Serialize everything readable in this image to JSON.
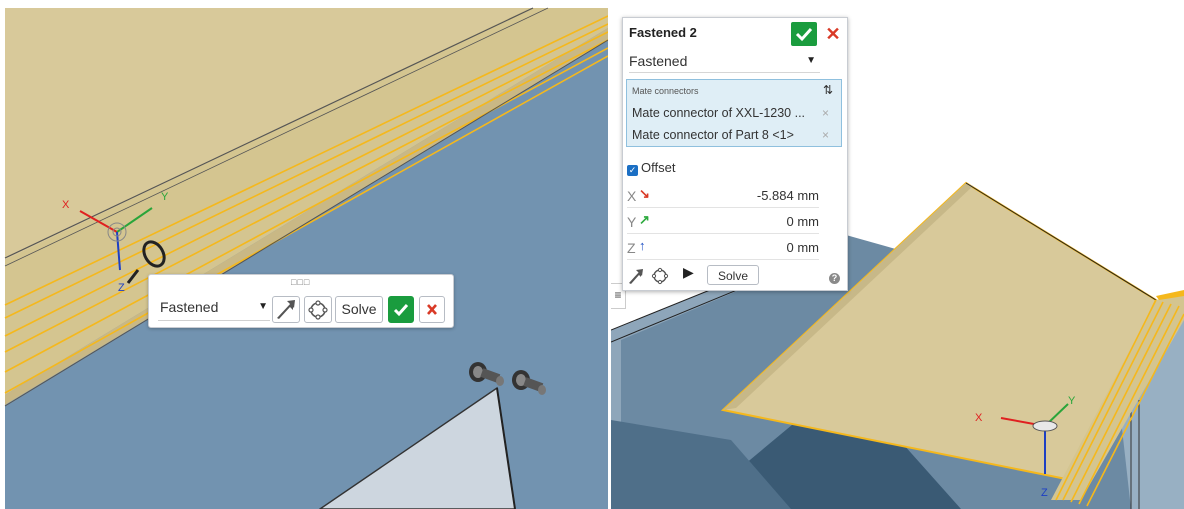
{
  "left_view": {
    "triad": {
      "x_label": "X",
      "y_label": "Y",
      "z_label": "Z"
    }
  },
  "mini_toolbar": {
    "mate_type": "Fastened",
    "solve_label": "Solve"
  },
  "dialog": {
    "title": "Fastened 2",
    "mate_type": "Fastened",
    "connectors_title": "Mate connectors",
    "connectors": [
      {
        "label": "Mate connector of XXL-1230 ...",
        "remove": "×"
      },
      {
        "label": "Mate connector of Part 8 <1>",
        "remove": "×"
      }
    ],
    "offset_label": "Offset",
    "offset_checked": true,
    "coords": [
      {
        "axis": "X",
        "value": "-5.884 mm",
        "color": "#d93a27"
      },
      {
        "axis": "Y",
        "value": "0 mm",
        "color": "#2eaa3f"
      },
      {
        "axis": "Z",
        "value": "0 mm",
        "color": "#1d4fc4"
      }
    ],
    "solve_label": "Solve",
    "help_label": "?"
  },
  "right_view": {
    "triad": {
      "x_label": "X",
      "y_label": "Y",
      "z_label": "Z"
    }
  },
  "colors": {
    "viewport_blue": "#7293b0",
    "part_tan": "#d8c99a",
    "highlight_orange": "#f5b81c",
    "accept_green": "#1a9c3e",
    "cancel_red": "#d93a27"
  }
}
